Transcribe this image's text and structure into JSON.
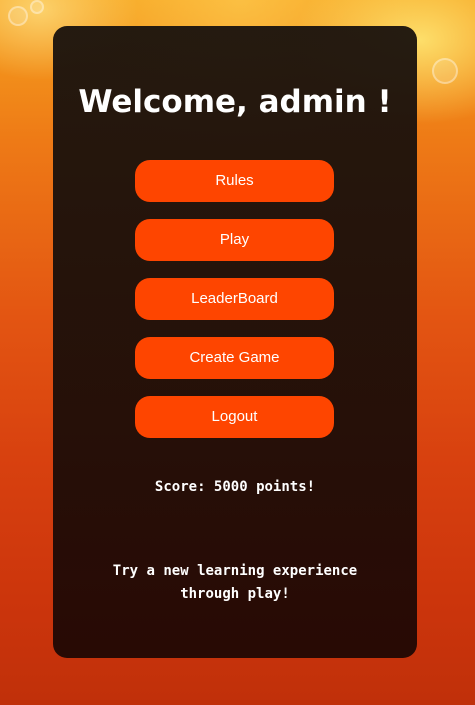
{
  "welcome_title": "Welcome, admin !",
  "menu": {
    "rules": "Rules",
    "play": "Play",
    "leaderboard": "LeaderBoard",
    "create_game": "Create Game",
    "logout": "Logout"
  },
  "score_text": "Score: 5000 points!",
  "tagline": "Try a new learning experience through play!",
  "colors": {
    "button": "#fe4500",
    "panel": "#1c140e",
    "text": "#ffffff"
  }
}
